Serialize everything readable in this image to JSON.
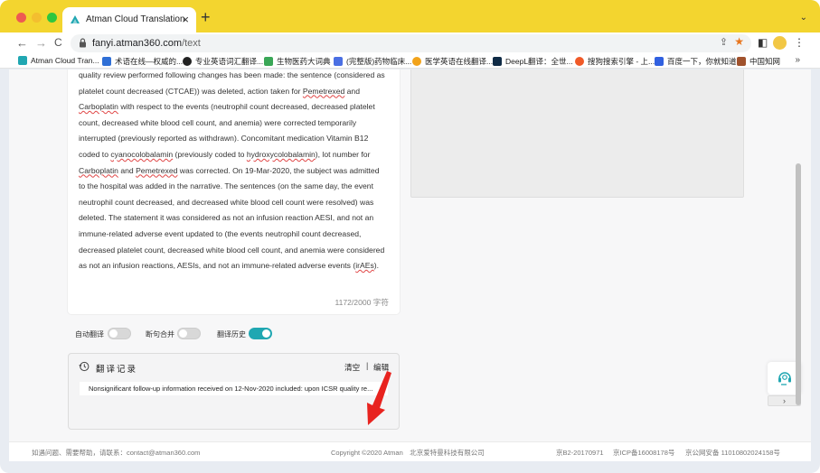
{
  "browser": {
    "tab_title": "Atman Cloud Translation",
    "tab_close": "×",
    "new_tab": "+",
    "tab_menu": "⌄",
    "url_host": "fanyi.atman360.com",
    "url_path": "/text",
    "nav": {
      "back": "←",
      "forward": "→",
      "reload": "C"
    }
  },
  "bookmarks": [
    {
      "label": "Atman Cloud Tran...",
      "color": "#20a7b2"
    },
    {
      "label": "术语在线—权威的...",
      "color": "#2f6fd6"
    },
    {
      "label": "专业英语词汇翻译...",
      "color": "#222222"
    },
    {
      "label": "生物医药大词典",
      "color": "#3aa757"
    },
    {
      "label": "(完整版)药物临床...",
      "color": "#4a6fe3"
    },
    {
      "label": "医学英语在线翻译...",
      "color": "#f2a31b"
    },
    {
      "label": "DeepL翻译：全世...",
      "color": "#0f2b46"
    },
    {
      "label": "搜狗搜索引擎 - 上...",
      "color": "#f05a28"
    },
    {
      "label": "百度一下，你就知道",
      "color": "#3060e0"
    },
    {
      "label": "中国知网",
      "color": "#a0522d"
    }
  ],
  "bookmarks_more": "»",
  "source": {
    "segments": [
      {
        "t": "quality review performed following changes has been made: the sentence (considered as platelet count decreased (CTCAE)) was deleted, action taken for "
      },
      {
        "t": "Pemetrexed",
        "u": true
      },
      {
        "t": " and "
      },
      {
        "t": "Carboplatin",
        "u": true
      },
      {
        "t": " with respect to the events (neutrophil count decreased, decreased platelet count, decreased white blood cell count, and anemia) were corrected temporarily interrupted (previously reported as withdrawn). Concomitant medication Vitamin B12 coded to "
      },
      {
        "t": "cyanocolobalamin",
        "u": true
      },
      {
        "t": " (previously coded to "
      },
      {
        "t": "hydroxycolobalamin",
        "u": true
      },
      {
        "t": "), lot number for "
      },
      {
        "t": "Carboplatin",
        "u": true
      },
      {
        "t": " and "
      },
      {
        "t": "Pemetrexed",
        "u": true
      },
      {
        "t": " was corrected. On 19-Mar-2020, the subject was admitted to the hospital was added in the narrative. The sentences (on the same day, the event neutrophil count decreased, and decreased white blood cell count were resolved) was deleted. The statement it was considered as not an infusion reaction AESI, and not an immune-related adverse event updated to (the events neutrophil count decreased, decreased platelet count, decreased white blood cell count, and anemia were considered as not an infusion reactions, AESIs, and not an immune-related adverse events ("
      },
      {
        "t": "irAEs",
        "u": true
      },
      {
        "t": ")."
      }
    ],
    "char_count": "1172/2000 字符"
  },
  "toggles": [
    {
      "label": "自动翻译",
      "on": false
    },
    {
      "label": "断句合并",
      "on": false
    },
    {
      "label": "翻译历史",
      "on": true
    }
  ],
  "history": {
    "title": "翻译记录",
    "clear": "清空",
    "separator": "|",
    "edit": "编辑",
    "items": [
      "Nonsignificant follow-up information received on 12-Nov-2020 included: upon ICSR quality re..."
    ]
  },
  "float_next": "›",
  "footer": {
    "contact": "如遇问题、需要帮助，请联系：contact@atman360.com",
    "copyright": "Copyright ©2020 Atman　北京爱特曼科技有限公司",
    "icp1": "京B2-20170971",
    "icp2": "京ICP备16008178号",
    "police": "京公网安备 11010802024158号"
  },
  "colors": {
    "accent": "#20a7b2",
    "chrome": "#f3d52f",
    "annotation_arrow": "#e8231f"
  }
}
